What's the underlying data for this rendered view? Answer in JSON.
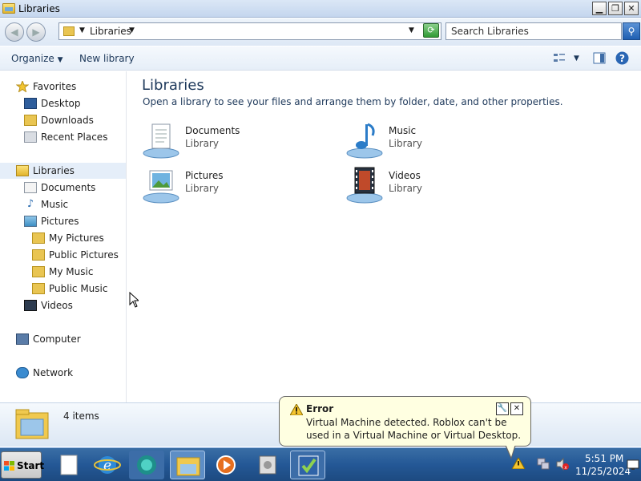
{
  "window": {
    "title": "Libraries",
    "minimize": "▁",
    "maximize": "❐",
    "close": "✕"
  },
  "nav": {
    "back": "◀",
    "forward": "▶",
    "address": "Libraries",
    "search_placeholder": "Search Libraries"
  },
  "toolbar": {
    "organize": "Organize",
    "new_library": "New library"
  },
  "sidebar": {
    "favorites": {
      "label": "Favorites",
      "items": [
        "Desktop",
        "Downloads",
        "Recent Places"
      ]
    },
    "libraries": {
      "label": "Libraries",
      "items": [
        "Documents",
        "Music",
        "Pictures",
        "My Pictures",
        "Public Pictures",
        "My Music",
        "Public Music",
        "Videos"
      ]
    },
    "computer": "Computer",
    "network": "Network"
  },
  "main": {
    "title": "Libraries",
    "subtitle": "Open a library to see your files and arrange them by folder, date, and other properties.",
    "libraries": [
      {
        "name": "Documents",
        "type": "Library"
      },
      {
        "name": "Music",
        "type": "Library"
      },
      {
        "name": "Pictures",
        "type": "Library"
      },
      {
        "name": "Videos",
        "type": "Library"
      }
    ]
  },
  "details": {
    "count": "4 items"
  },
  "balloon": {
    "title": "Error",
    "message": "Virtual Machine detected. Roblox can't be used in a Virtual Machine or Virtual Desktop."
  },
  "taskbar": {
    "start": "Start",
    "time": "5:51 PM",
    "date": "11/25/2024"
  },
  "colors": {
    "accent": "#1e395b",
    "taskbar": "#245896",
    "balloon": "#ffffe1"
  }
}
